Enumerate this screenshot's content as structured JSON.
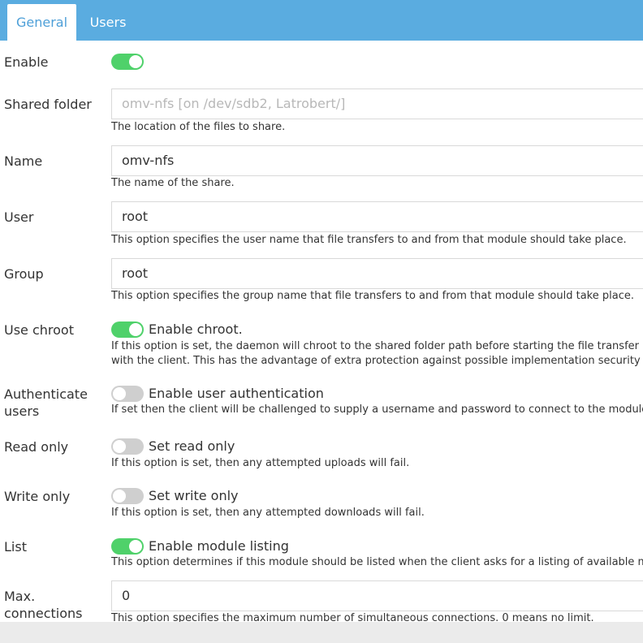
{
  "tabs": [
    {
      "label": "General",
      "active": true
    },
    {
      "label": "Users",
      "active": false
    }
  ],
  "form": {
    "enable": {
      "label": "Enable",
      "checked": true
    },
    "shared_folder": {
      "label": "Shared folder",
      "placeholder": "omv-nfs [on /dev/sdb2, Latrobert/]",
      "hint": "The location of the files to share."
    },
    "name": {
      "label": "Name",
      "value": "omv-nfs",
      "hint": "The name of the share."
    },
    "user": {
      "label": "User",
      "value": "root",
      "hint": "This option specifies the user name that file transfers to and from that module should take place."
    },
    "group": {
      "label": "Group",
      "value": "root",
      "hint": "This option specifies the group name that file transfers to and from that module should take place."
    },
    "use_chroot": {
      "label": "Use chroot",
      "checked": true,
      "toggle_label": "Enable chroot.",
      "hint": "If this option is set, the daemon will chroot to the shared folder path before starting the file transfer with the client. This has the advantage of extra protection against possible implementation security holes, but it has the disadvantages of requiring super-user privileges, of not being able to follow symbolic links that are either absolute or outside of the new root path."
    },
    "authenticate_users": {
      "label": "Authenticate users",
      "checked": false,
      "toggle_label": "Enable user authentication",
      "hint": "If set then the client will be challenged to supply a username and password to connect to the module."
    },
    "read_only": {
      "label": "Read only",
      "checked": false,
      "toggle_label": "Set read only",
      "hint": "If this option is set, then any attempted uploads will fail."
    },
    "write_only": {
      "label": "Write only",
      "checked": false,
      "toggle_label": "Set write only",
      "hint": "If this option is set, then any attempted downloads will fail."
    },
    "list": {
      "label": "List",
      "checked": true,
      "toggle_label": "Enable module listing",
      "hint": "This option determines if this module should be listed when the client asks for a listing of available modules."
    },
    "max_connections": {
      "label": "Max. connections",
      "value": "0",
      "hint": "This option specifies the maximum number of simultaneous connections. 0 means no limit."
    }
  },
  "colors": {
    "tabbar": "#5aace0",
    "active_tab_text": "#4d9fd8",
    "toggle_on": "#4fd16a",
    "toggle_off": "#cfcfcf"
  }
}
